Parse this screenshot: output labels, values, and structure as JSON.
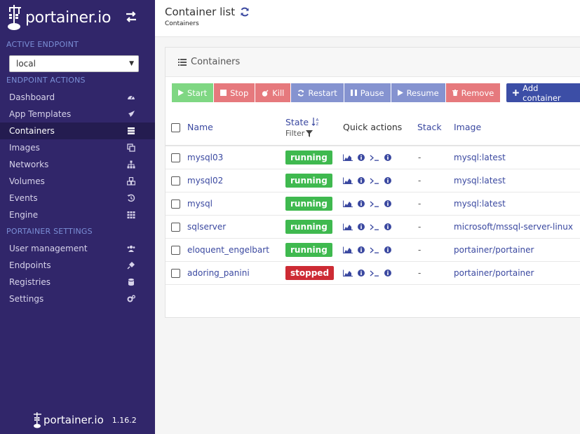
{
  "brand": {
    "name": "portainer.io"
  },
  "sidebar": {
    "active_endpoint_title": "ACTIVE ENDPOINT",
    "endpoint_value": "local",
    "endpoint_actions_title": "ENDPOINT ACTIONS",
    "items": [
      {
        "label": "Dashboard",
        "icon": "dashboard-icon"
      },
      {
        "label": "App Templates",
        "icon": "rocket-icon"
      },
      {
        "label": "Containers",
        "icon": "server-icon",
        "active": true
      },
      {
        "label": "Images",
        "icon": "clone-icon"
      },
      {
        "label": "Networks",
        "icon": "sitemap-icon"
      },
      {
        "label": "Volumes",
        "icon": "cubes-icon"
      },
      {
        "label": "Events",
        "icon": "history-icon"
      },
      {
        "label": "Engine",
        "icon": "th-icon"
      }
    ],
    "settings_title": "PORTAINER SETTINGS",
    "settings_items": [
      {
        "label": "User management",
        "icon": "users-icon"
      },
      {
        "label": "Endpoints",
        "icon": "plug-icon"
      },
      {
        "label": "Registries",
        "icon": "database-icon"
      },
      {
        "label": "Settings",
        "icon": "cogs-icon"
      }
    ],
    "footer_brand": "portainer.io",
    "version": "1.16.2"
  },
  "header": {
    "title": "Container list",
    "breadcrumb": "Containers"
  },
  "panel": {
    "title": "Containers",
    "buttons": {
      "start": "Start",
      "stop": "Stop",
      "kill": "Kill",
      "restart": "Restart",
      "pause": "Pause",
      "resume": "Resume",
      "remove": "Remove",
      "add": "Add container"
    },
    "columns": {
      "name": "Name",
      "state": "State",
      "filter": "Filter",
      "quick_actions": "Quick actions",
      "stack": "Stack",
      "image": "Image"
    },
    "rows": [
      {
        "name": "mysql03",
        "state": "running",
        "stack": "-",
        "image": "mysql:latest"
      },
      {
        "name": "mysql02",
        "state": "running",
        "stack": "-",
        "image": "mysql:latest"
      },
      {
        "name": "mysql",
        "state": "running",
        "stack": "-",
        "image": "mysql:latest"
      },
      {
        "name": "sqlserver",
        "state": "running",
        "stack": "-",
        "image": "microsoft/mssql-server-linux"
      },
      {
        "name": "eloquent_engelbart",
        "state": "running",
        "stack": "-",
        "image": "portainer/portainer"
      },
      {
        "name": "adoring_panini",
        "state": "stopped",
        "stack": "-",
        "image": "portainer/portainer"
      }
    ]
  },
  "colors": {
    "sidebar_bg": "#31266a",
    "running": "#3fb94f",
    "stopped": "#cd2b34",
    "link": "#3a48a0"
  }
}
